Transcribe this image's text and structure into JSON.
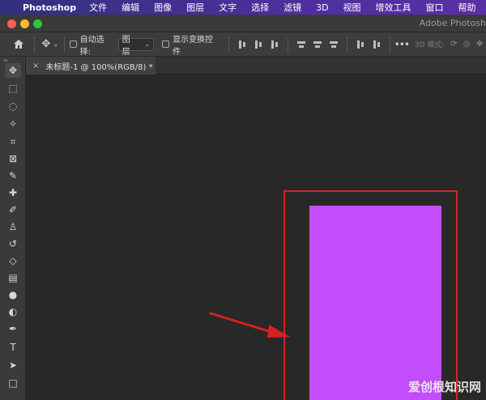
{
  "menubar": {
    "apple_icon": "apple-logo-icon",
    "app_name": "Photoshop",
    "items": [
      "文件",
      "编辑",
      "图像",
      "图层",
      "文字",
      "选择",
      "滤镜",
      "3D",
      "视图",
      "增效工具",
      "窗口",
      "帮助"
    ]
  },
  "window": {
    "title": "Adobe Photosh"
  },
  "options_bar": {
    "auto_select_label": "自动选择:",
    "auto_select_value": "图层",
    "show_transform_label": "显示变换控件",
    "mode_3d_label": "3D 模式:"
  },
  "document": {
    "tab_title": "未标题-1 @ 100%(RGB/8) *",
    "close_glyph": "×"
  },
  "tools": [
    {
      "name": "move-tool-icon",
      "glyph": "✥",
      "active": true
    },
    {
      "name": "rect-marquee-tool-icon",
      "glyph": "⬚"
    },
    {
      "name": "lasso-tool-icon",
      "glyph": "◌"
    },
    {
      "name": "magic-wand-tool-icon",
      "glyph": "✧"
    },
    {
      "name": "crop-tool-icon",
      "glyph": "⌗"
    },
    {
      "name": "frame-tool-icon",
      "glyph": "⊠"
    },
    {
      "name": "eyedropper-tool-icon",
      "glyph": "✎"
    },
    {
      "name": "healing-brush-tool-icon",
      "glyph": "✚"
    },
    {
      "name": "brush-tool-icon",
      "glyph": "✐"
    },
    {
      "name": "clone-stamp-tool-icon",
      "glyph": "♙"
    },
    {
      "name": "history-brush-tool-icon",
      "glyph": "↺"
    },
    {
      "name": "eraser-tool-icon",
      "glyph": "◇"
    },
    {
      "name": "gradient-tool-icon",
      "glyph": "▤"
    },
    {
      "name": "blur-tool-icon",
      "glyph": "●"
    },
    {
      "name": "dodge-tool-icon",
      "glyph": "◐"
    },
    {
      "name": "pen-tool-icon",
      "glyph": "✒"
    },
    {
      "name": "type-tool-icon",
      "glyph": "T"
    },
    {
      "name": "path-selection-tool-icon",
      "glyph": "➤"
    },
    {
      "name": "rectangle-tool-icon",
      "glyph": "□"
    }
  ],
  "colors": {
    "shape_fill": "#c14dfb",
    "highlight_stroke": "#d62121"
  },
  "watermark": {
    "text": "爱创根知识网"
  }
}
